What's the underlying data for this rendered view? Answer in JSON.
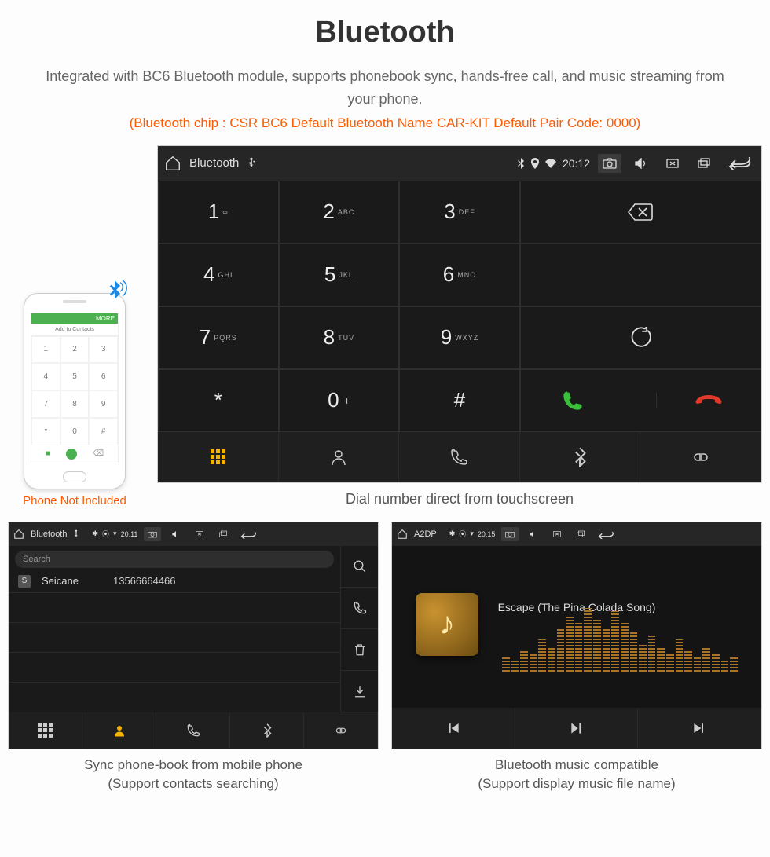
{
  "header": {
    "title": "Bluetooth",
    "subtitle": "Integrated with BC6 Bluetooth module, supports phonebook sync, hands-free call, and music streaming from your phone.",
    "redline": "(Bluetooth chip : CSR BC6    Default Bluetooth Name CAR-KIT    Default Pair Code: 0000)"
  },
  "phone": {
    "more": "MORE",
    "add": "Add to Contacts",
    "keys": [
      "1",
      "2",
      "3",
      "4",
      "5",
      "6",
      "7",
      "8",
      "9",
      "*",
      "0",
      "#"
    ],
    "note": "Phone Not Included"
  },
  "dialer": {
    "status": {
      "app": "Bluetooth",
      "time": "20:12"
    },
    "keys": [
      {
        "n": "1",
        "s": "∞"
      },
      {
        "n": "2",
        "s": "ABC"
      },
      {
        "n": "3",
        "s": "DEF"
      },
      {
        "n": "4",
        "s": "GHI"
      },
      {
        "n": "5",
        "s": "JKL"
      },
      {
        "n": "6",
        "s": "MNO"
      },
      {
        "n": "7",
        "s": "PQRS"
      },
      {
        "n": "8",
        "s": "TUV"
      },
      {
        "n": "9",
        "s": "WXYZ"
      },
      {
        "n": "*",
        "s": ""
      },
      {
        "n": "0",
        "s": "+",
        "plus": true
      },
      {
        "n": "#",
        "s": ""
      }
    ],
    "caption": "Dial number direct from touchscreen"
  },
  "contacts": {
    "status": {
      "app": "Bluetooth",
      "time": "20:11"
    },
    "search": "Search",
    "row": {
      "initial": "S",
      "name": "Seicane",
      "number": "13566664466"
    },
    "caption_l1": "Sync phone-book from mobile phone",
    "caption_l2": "(Support contacts searching)"
  },
  "music": {
    "status": {
      "app": "A2DP",
      "time": "20:15"
    },
    "song": "Escape (The Pina Colada Song)",
    "caption_l1": "Bluetooth music compatible",
    "caption_l2": "(Support display music file name)"
  }
}
